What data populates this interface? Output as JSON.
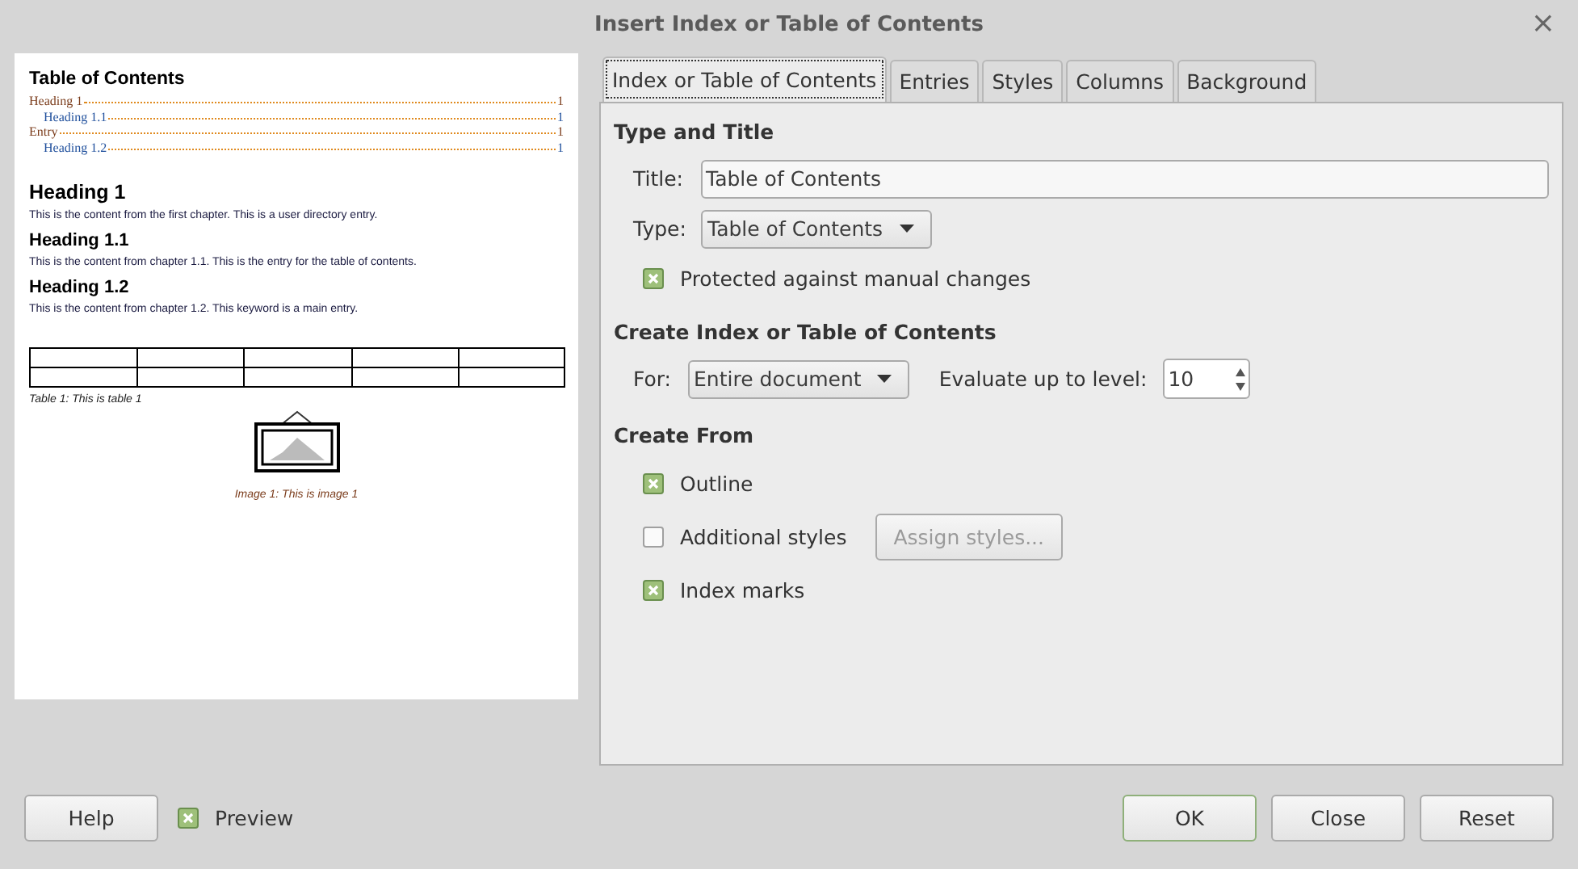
{
  "window": {
    "title": "Insert Index or Table of Contents",
    "close": "×"
  },
  "preview": {
    "toc_title": "Table of Contents",
    "toc_entries": [
      {
        "text": "Heading 1",
        "page": "1",
        "children": [
          {
            "text": "Heading 1.1",
            "page": "1"
          }
        ]
      },
      {
        "text": "Entry",
        "page": "1",
        "children": [
          {
            "text": "Heading 1.2",
            "page": "1"
          }
        ]
      }
    ],
    "sections": [
      {
        "heading": "Heading 1",
        "text": "This is the content from the first chapter. This is a user directory entry.",
        "children": [
          {
            "heading": "Heading 1.1",
            "text": "This is the content from chapter 1.1. This is the entry for the table of contents."
          },
          {
            "heading": "Heading 1.2",
            "text": "This is the content from chapter 1.2. This keyword is a main entry."
          }
        ]
      }
    ],
    "table_caption": "Table 1: This is table 1",
    "image_caption": "Image 1: This is image 1"
  },
  "tabs": [
    {
      "label": "Index or Table of Contents",
      "selected": true
    },
    {
      "label": "Entries",
      "selected": false
    },
    {
      "label": "Styles",
      "selected": false
    },
    {
      "label": "Columns",
      "selected": false
    },
    {
      "label": "Background",
      "selected": false
    }
  ],
  "type_and_title": {
    "heading": "Type and Title",
    "title_label": "Title:",
    "title_value": "Table of Contents",
    "type_label": "Type:",
    "type_value": "Table of Contents",
    "protected": {
      "label": "Protected against manual changes",
      "checked": true
    }
  },
  "create_index": {
    "heading": "Create Index or Table of Contents",
    "for_label": "For:",
    "for_value": "Entire document",
    "level_label": "Evaluate up to level:",
    "level_value": "10"
  },
  "create_from": {
    "heading": "Create From",
    "options": [
      {
        "label": "Outline",
        "checked": true
      },
      {
        "label": "Additional styles",
        "checked": false,
        "button": {
          "label": "Assign styles...",
          "disabled": true
        }
      },
      {
        "label": "Index marks",
        "checked": true
      }
    ]
  },
  "footer": {
    "help": "Help",
    "preview": {
      "label": "Preview",
      "checked": true
    },
    "buttons": [
      {
        "label": "OK",
        "default": true
      },
      {
        "label": "Close",
        "default": false
      },
      {
        "label": "Reset",
        "default": false
      }
    ]
  }
}
